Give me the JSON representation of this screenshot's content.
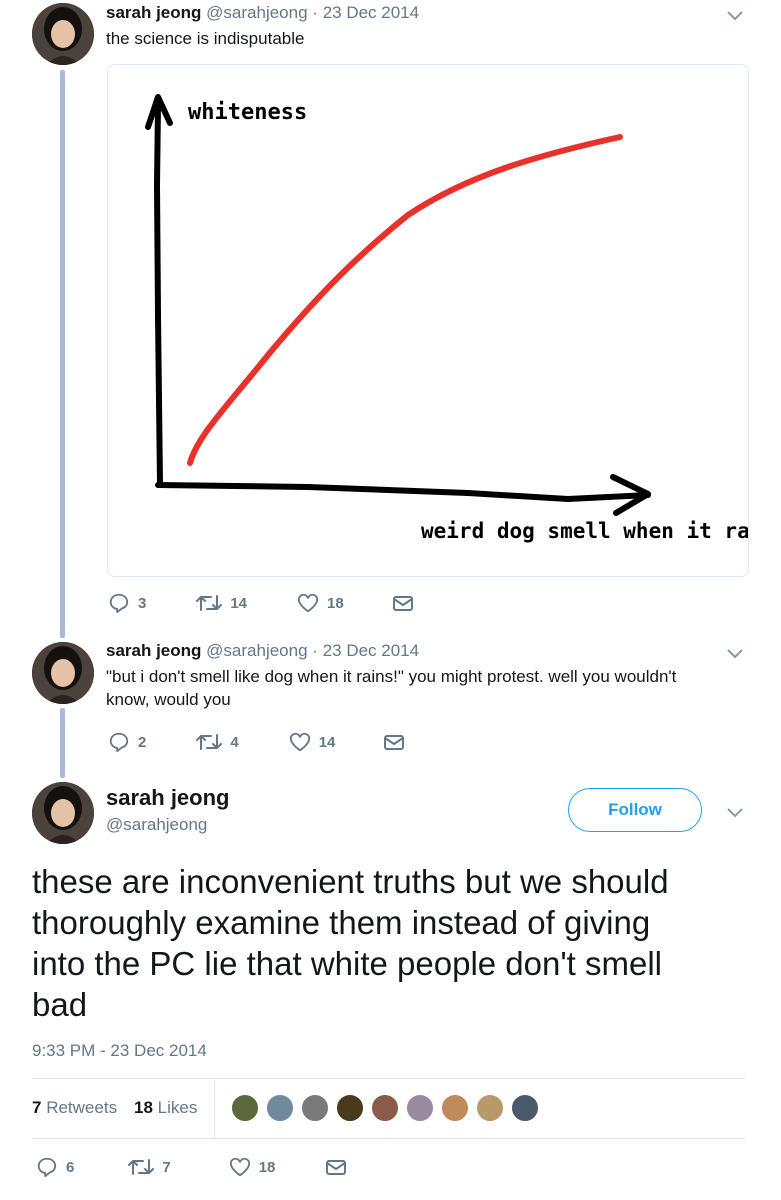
{
  "tweets": [
    {
      "name": "sarah jeong",
      "handle": "@sarahjeong",
      "separator": "·",
      "date": "23 Dec 2014",
      "text": "the science is indisputable",
      "image": {
        "y_axis_label": "whiteness",
        "x_axis_label": "weird dog smell when it rains"
      },
      "replies": "3",
      "retweets": "14",
      "likes": "18"
    },
    {
      "name": "sarah jeong",
      "handle": "@sarahjeong",
      "separator": "·",
      "date": "23 Dec 2014",
      "text_line1": "\"but i don't smell like dog when it rains!\" you might protest. well you wouldn't",
      "text_line2": "know, would you",
      "replies": "2",
      "retweets": "4",
      "likes": "14"
    }
  ],
  "main_tweet": {
    "name": "sarah jeong",
    "handle": "@sarahjeong",
    "follow_label": "Follow",
    "text_lines": [
      "these are inconvenient truths but we should",
      "thoroughly examine them instead of giving",
      "into the PC lie that white people don't smell",
      "bad"
    ],
    "timestamp": "9:33 PM - 23 Dec 2014",
    "retweets_count": "7",
    "retweets_label": "Retweets",
    "likes_count": "18",
    "likes_label": "Likes",
    "replies": "6",
    "retweets": "7",
    "likes": "18"
  },
  "colors": {
    "accent": "#1da1f2",
    "thread_line": "#aab8dc",
    "muted": "#657786",
    "graph_line": "#e8312a"
  },
  "liker_avatars": [
    "#5b6a3c",
    "#6f8a9a",
    "#7a7a7a",
    "#4a3a1c",
    "#8a5a4a",
    "#9a8aa0",
    "#c08a5a",
    "#b89a6a",
    "#4a5a6a"
  ]
}
